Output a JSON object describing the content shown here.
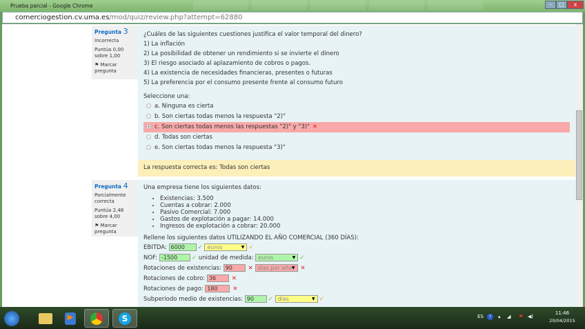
{
  "window": {
    "title": "Prueba parcial - Google Chrome",
    "url_host": "comerciogestion.cv.uma.es",
    "url_path": "/mod/quiz/review.php?attempt=62880"
  },
  "q3": {
    "label": "Pregunta",
    "number": "3",
    "state": "Incorrecta",
    "score": "Puntúa 0,00 sobre 1,00",
    "flag": "Marcar pregunta",
    "text": "¿Cuáles de las siguientes cuestiones justifica el valor temporal del dinero?",
    "items": [
      "1) La inflación",
      "2) La posibilidad de obtener un rendimiento si se invierte el dinero",
      "3) El riesgo asociado al aplazamiento de cobros o pagos.",
      "4) La existencia de necesidades financieras, presentes o futuras",
      "5) La preferencia por el consumo presente frente al consumo futuro"
    ],
    "prompt": "Seleccione una:",
    "options": [
      "a. Ninguna es cierta",
      "b. Son ciertas todas menos la respuesta \"2)\"",
      "c. Son ciertas todas menos las respuestas \"2)\" y \"3)\"",
      "d. Todas son ciertas",
      "e. Son ciertas todas menos la respuesta \"3)\""
    ],
    "selected": 2,
    "feedback": "La respuesta correcta es: Todas son ciertas"
  },
  "q4": {
    "label": "Pregunta",
    "number": "4",
    "state": "Parcialmente correcta",
    "score": "Puntúa 2,48 sobre 4,00",
    "flag": "Marcar pregunta",
    "text": "Una empresa tiene los siguientes datos:",
    "items": [
      "Existencias: 3.500",
      "Cuentas a cobrar: 2.000",
      "Pasivo Comercial: 7.000",
      "Gastos de explotación a pagar: 14.000",
      "Ingresos de explotación a cobrar: 20.000"
    ],
    "prompt": "Rellene los siguientes datos UTILIZANDO EL AÑO COMERCIAL (360 DÍAS):",
    "fields": [
      {
        "label": "EBITDA:",
        "value": "6000",
        "state": "correct",
        "unit": "euros",
        "unit_state": "partial"
      },
      {
        "label": "NOF:",
        "value": "-1500",
        "state": "correct",
        "unit_label": "unidad de medida:",
        "unit": "euros",
        "unit_state": "correct"
      },
      {
        "label": "Rotaciones de existencias:",
        "value": "90",
        "state": "incorrect",
        "unit": "días por año",
        "unit_state": "incorrect"
      },
      {
        "label": "Rotaciones de cobro:",
        "value": "36",
        "state": "incorrect"
      },
      {
        "label": "Rotaciones de pago:",
        "value": "180",
        "state": "incorrect"
      },
      {
        "label": "Subperiodo medio de existencias:",
        "value": "90",
        "state": "correct",
        "unit": "días",
        "unit_state": "partial"
      }
    ]
  },
  "taskbar": {
    "lang": "ES",
    "time": "11:46",
    "date": "20/04/2015"
  },
  "colors": {
    "correct": "#aff5a9",
    "incorrect": "#f9a9a9",
    "partial": "#ffff88",
    "accent": "#0f6cbf"
  }
}
